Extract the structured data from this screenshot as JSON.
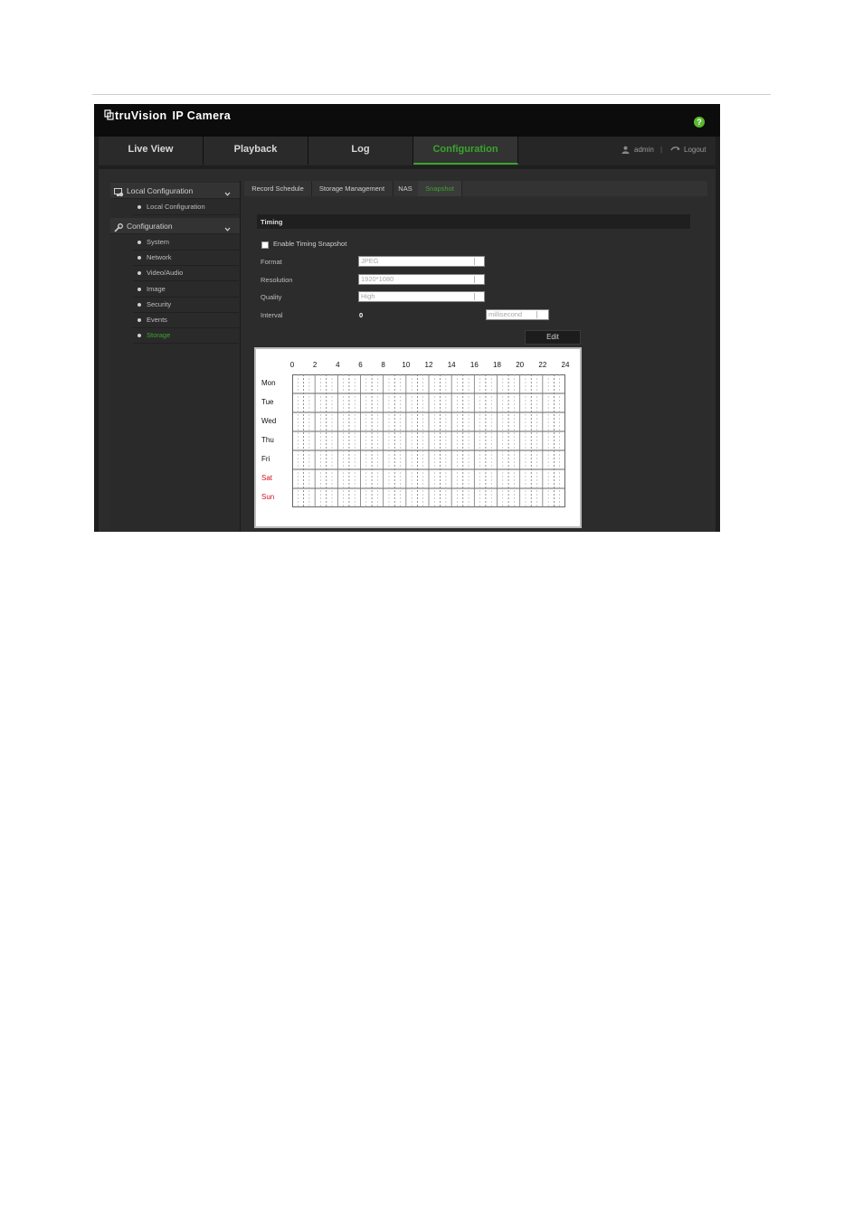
{
  "app": {
    "brand": "truVision",
    "product": "IP Camera",
    "help_label": "?"
  },
  "nav": {
    "tabs": [
      {
        "label": "Live View",
        "active": false
      },
      {
        "label": "Playback",
        "active": false
      },
      {
        "label": "Log",
        "active": false
      },
      {
        "label": "Configuration",
        "active": true
      }
    ],
    "user": "admin",
    "logout": "Logout"
  },
  "sidebar": {
    "groups": [
      {
        "label": "Local Configuration",
        "icon": "monitor-gear-icon",
        "items": [
          "Local Configuration"
        ]
      },
      {
        "label": "Configuration",
        "icon": "wrench-icon",
        "items": [
          "System",
          "Network",
          "Video/Audio",
          "Image",
          "Security",
          "Events",
          "Storage"
        ]
      }
    ],
    "active_item": "Storage"
  },
  "subtabs": [
    {
      "label": "Record Schedule",
      "active": false
    },
    {
      "label": "Storage Management",
      "active": false
    },
    {
      "label": "NAS",
      "active": false
    },
    {
      "label": "Snapshot",
      "active": true
    }
  ],
  "timing": {
    "section_title": "Timing",
    "enable_label": "Enable Timing Snapshot",
    "enabled": false,
    "fields": [
      {
        "label": "Format",
        "value": "JPEG"
      },
      {
        "label": "Resolution",
        "value": "1920*1080"
      },
      {
        "label": "Quality",
        "value": "High"
      }
    ],
    "interval_label": "Interval",
    "interval_value": "0",
    "interval_unit": "millisecond",
    "edit_label": "Edit"
  },
  "schedule": {
    "hours": [
      "0",
      "2",
      "4",
      "6",
      "8",
      "10",
      "12",
      "14",
      "16",
      "18",
      "20",
      "22",
      "24"
    ],
    "days": [
      {
        "label": "Mon",
        "weekend": false
      },
      {
        "label": "Tue",
        "weekend": false
      },
      {
        "label": "Wed",
        "weekend": false
      },
      {
        "label": "Thu",
        "weekend": false
      },
      {
        "label": "Fri",
        "weekend": false
      },
      {
        "label": "Sat",
        "weekend": true
      },
      {
        "label": "Sun",
        "weekend": true
      }
    ]
  },
  "colors": {
    "accent": "#3aa52d",
    "weekend": "#d0101a",
    "background": "#2c2c2c"
  }
}
